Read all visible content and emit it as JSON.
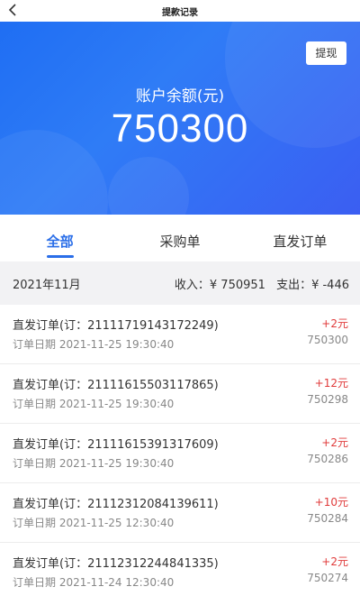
{
  "topbar": {
    "title": "提款记录"
  },
  "hero": {
    "withdraw_label": "提现",
    "balance_label": "账户余额(元)",
    "balance_value": "750300"
  },
  "tabs": [
    {
      "label": "全部"
    },
    {
      "label": "采购单"
    },
    {
      "label": "直发订单"
    }
  ],
  "summary": {
    "month": "2021年11月",
    "income": "收入：¥ 750951",
    "expense": "支出：¥ -446"
  },
  "records": [
    {
      "order": "直发订单(订：21111719143172249)",
      "date": "订单日期 2021-11-25 19:30:40",
      "delta": "+2元",
      "balance": "750300"
    },
    {
      "order": "直发订单(订：21111615503117865)",
      "date": "订单日期 2021-11-25 19:30:40",
      "delta": "+12元",
      "balance": "750298"
    },
    {
      "order": "直发订单(订：21111615391317609)",
      "date": "订单日期 2021-11-25 19:30:40",
      "delta": "+2元",
      "balance": "750286"
    },
    {
      "order": "直发订单(订：21112312084139611)",
      "date": "订单日期 2021-11-25 12:30:40",
      "delta": "+10元",
      "balance": "750284"
    },
    {
      "order": "直发订单(订：21112312244841335)",
      "date": "订单日期 2021-11-24 12:30:40",
      "delta": "+2元",
      "balance": "750274"
    }
  ]
}
